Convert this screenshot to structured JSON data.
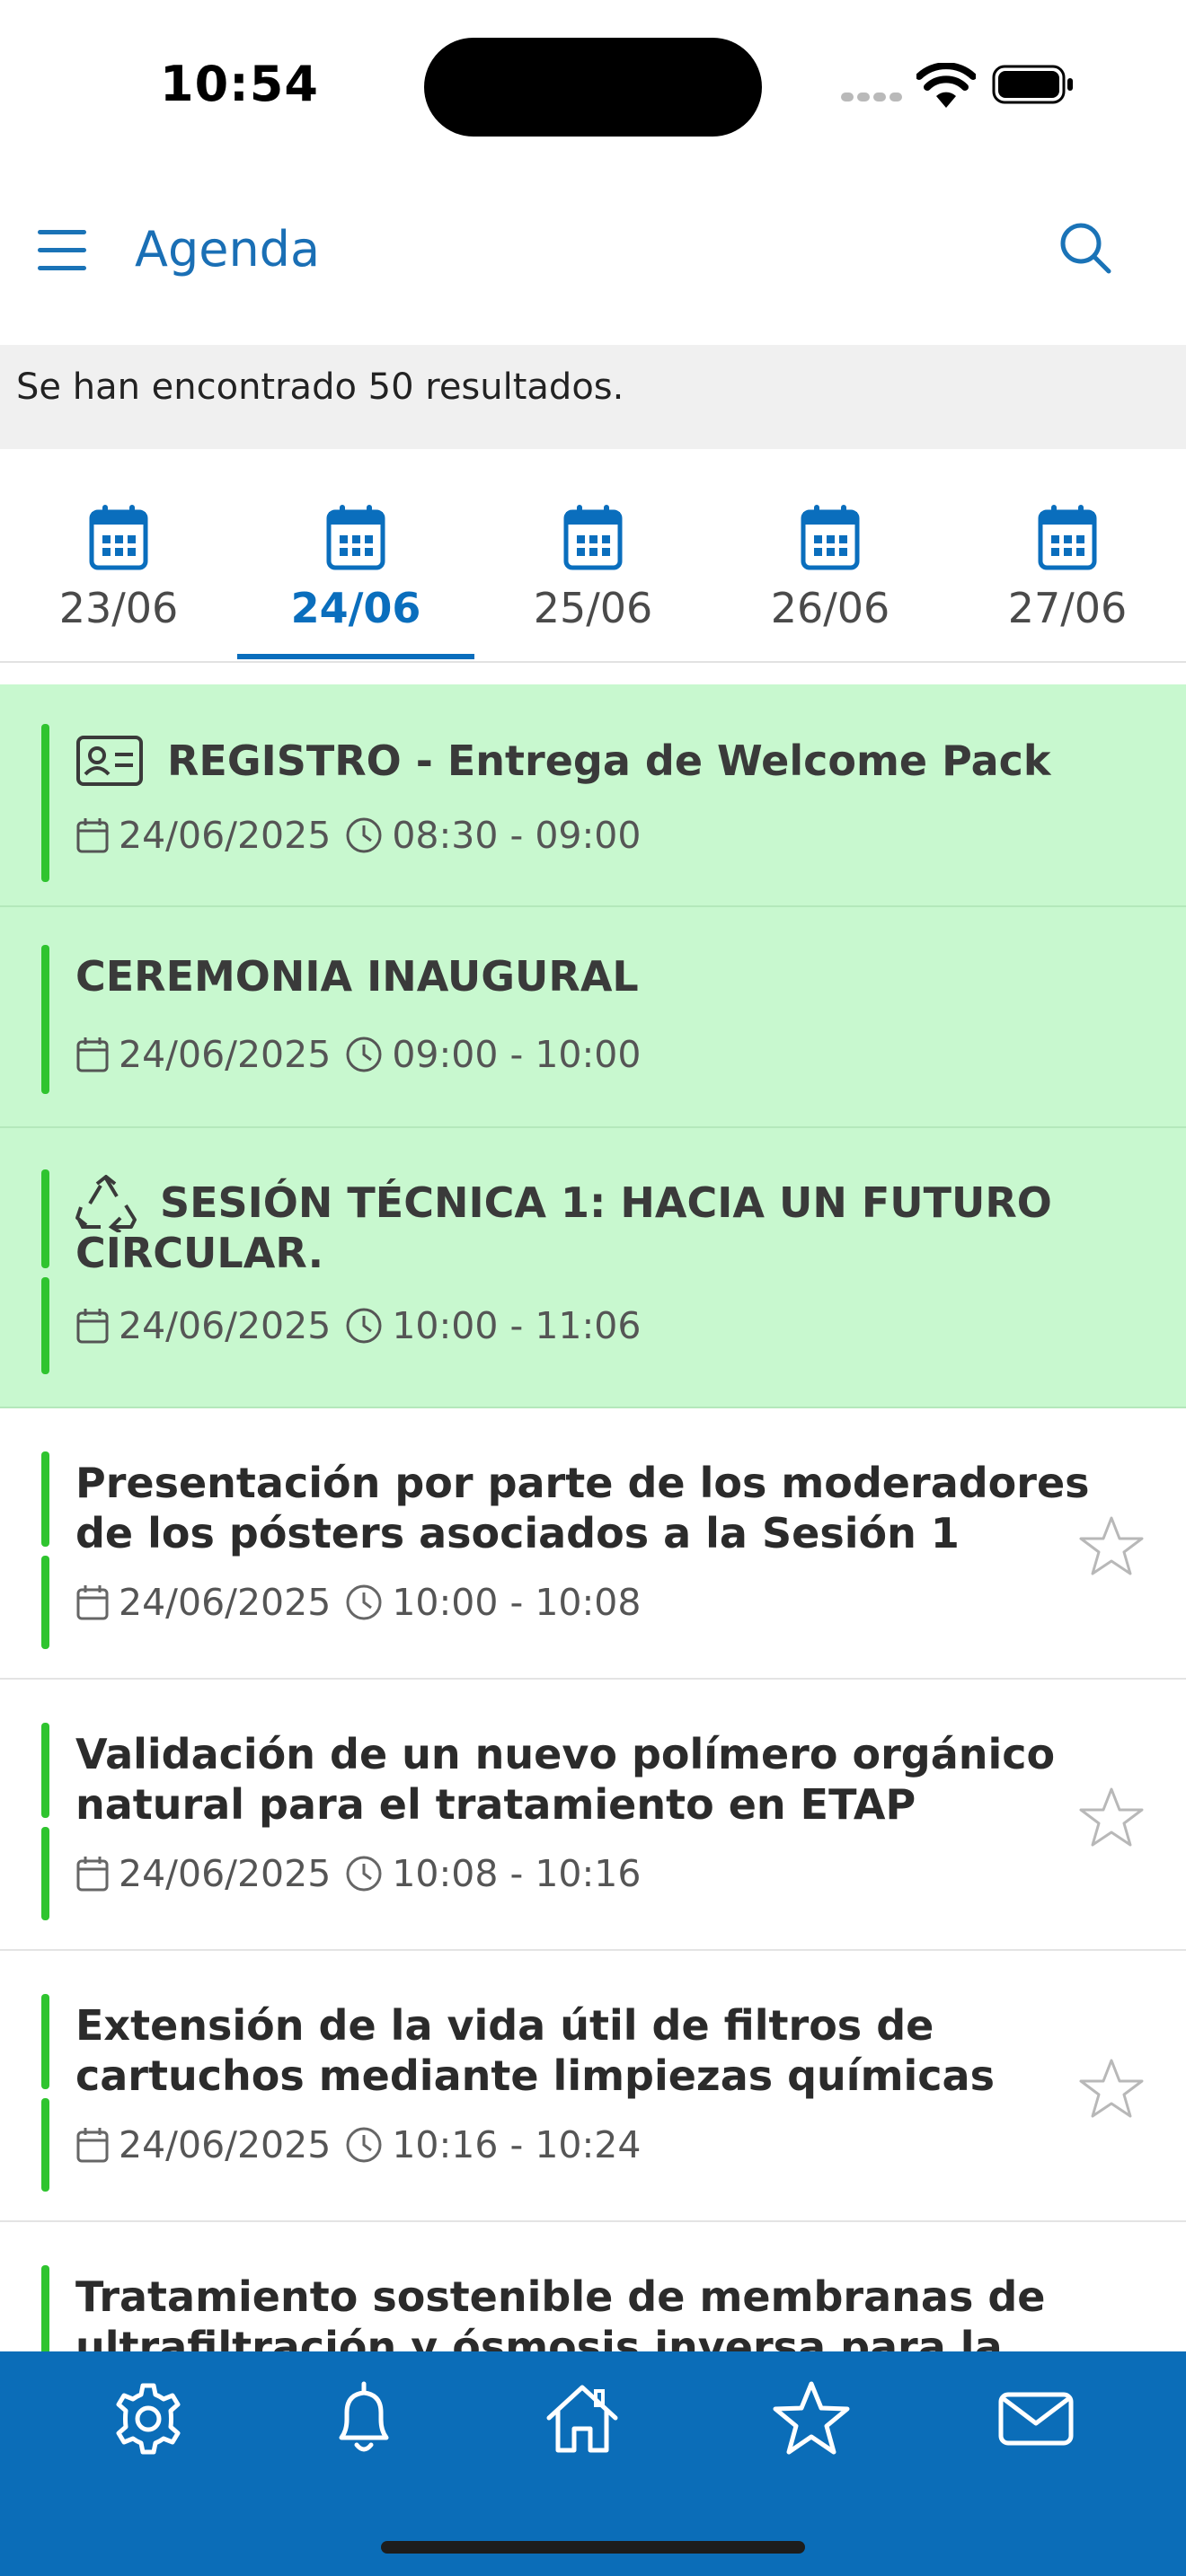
{
  "status_bar": {
    "time": "10:54"
  },
  "header": {
    "title": "Agenda",
    "menu_icon": "hamburger-menu-icon",
    "search_icon": "search-icon"
  },
  "results": {
    "text": "Se han encontrado 50 resultados."
  },
  "date_tabs": [
    {
      "label": "23/06",
      "active": false
    },
    {
      "label": "24/06",
      "active": true
    },
    {
      "label": "25/06",
      "active": false
    },
    {
      "label": "26/06",
      "active": false
    },
    {
      "label": "27/06",
      "active": false
    }
  ],
  "agenda_items": [
    {
      "title_line1": "REGISTRO - Entrega de Welcome Pack",
      "title_line2": "",
      "icon": "id-card-icon",
      "date": "24/06/2025",
      "time": "08:30 - 09:00",
      "highlighted": true,
      "favorite": false
    },
    {
      "title_line1": "CEREMONIA INAUGURAL",
      "title_line2": "",
      "icon": "",
      "date": "24/06/2025",
      "time": "09:00 - 10:00",
      "highlighted": true,
      "favorite": false
    },
    {
      "title_line1": "SESIÓN TÉCNICA 1: HACIA UN FUTURO",
      "title_line2": "CIRCULAR.",
      "icon": "recycle-icon",
      "date": "24/06/2025",
      "time": "10:00 - 11:06",
      "highlighted": true,
      "favorite": false
    },
    {
      "title_line1": "Presentación por parte de los moderadores",
      "title_line2": "de los pósters asociados a la Sesión 1",
      "icon": "",
      "date": "24/06/2025",
      "time": "10:00 - 10:08",
      "highlighted": false,
      "favorite": false
    },
    {
      "title_line1": "Validación de un nuevo polímero orgánico",
      "title_line2": "natural para el tratamiento en ETAP",
      "icon": "",
      "date": "24/06/2025",
      "time": "10:08 - 10:16",
      "highlighted": false,
      "favorite": false
    },
    {
      "title_line1": "Extensión de la vida útil de filtros de",
      "title_line2": "cartuchos mediante limpiezas químicas",
      "icon": "",
      "date": "24/06/2025",
      "time": "10:16 - 10:24",
      "highlighted": false,
      "favorite": false
    },
    {
      "title_line1": "Tratamiento sostenible de membranas de",
      "title_line2": "ultrafiltración y ósmosis inversa para la",
      "icon": "",
      "date": "",
      "time": "",
      "highlighted": false,
      "favorite": false
    }
  ],
  "bottom_nav": [
    {
      "icon": "gear-icon"
    },
    {
      "icon": "bell-icon"
    },
    {
      "icon": "home-icon"
    },
    {
      "icon": "star-icon"
    },
    {
      "icon": "mail-icon"
    }
  ],
  "colors": {
    "accent": "#0a6ebd",
    "highlight_bg": "#c8f8cf",
    "status_bar_green": "#2fc42f",
    "nav_bg": "#0b6db8"
  }
}
